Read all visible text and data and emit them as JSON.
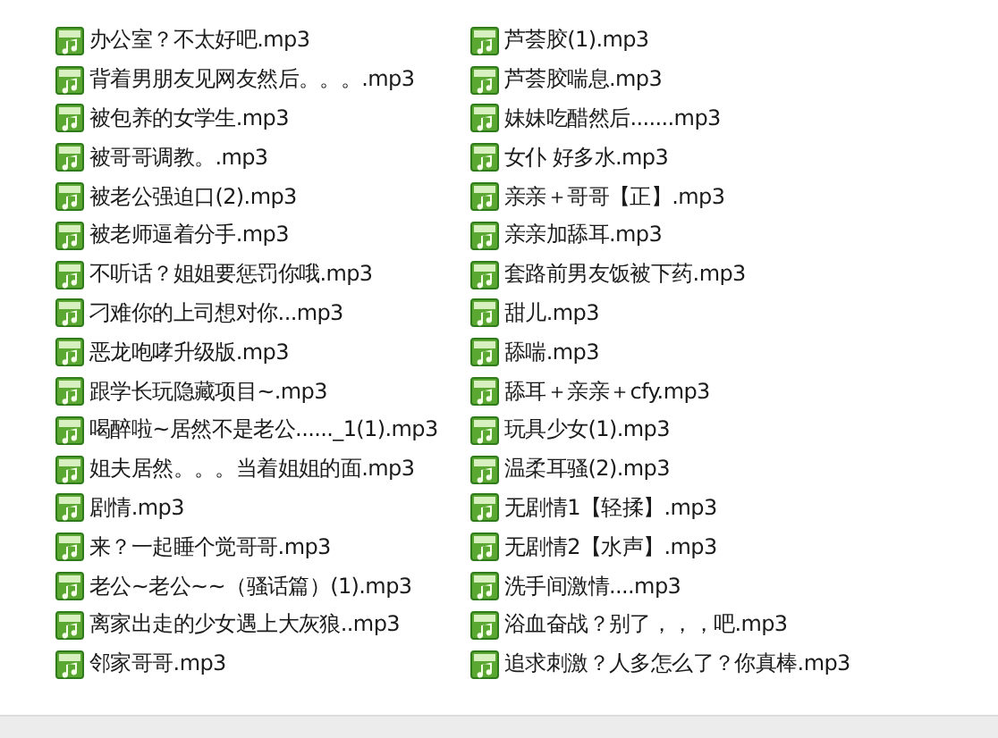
{
  "columns": [
    {
      "files": [
        {
          "name": "办公室？不太好吧.mp3"
        },
        {
          "name": "背着男朋友见网友然后。。。.mp3"
        },
        {
          "name": "被包养的女学生.mp3"
        },
        {
          "name": "被哥哥调教。.mp3"
        },
        {
          "name": "被老公强迫口(2).mp3"
        },
        {
          "name": "被老师逼着分手.mp3"
        },
        {
          "name": "不听话？姐姐要惩罚你哦.mp3"
        },
        {
          "name": "刁难你的上司想对你...mp3"
        },
        {
          "name": "恶龙咆哮升级版.mp3"
        },
        {
          "name": "跟学长玩隐藏项目~.mp3"
        },
        {
          "name": "喝醉啦~居然不是老公......_1(1).mp3"
        },
        {
          "name": "姐夫居然。。。当着姐姐的面.mp3"
        },
        {
          "name": "剧情.mp3"
        },
        {
          "name": "来？一起睡个觉哥哥.mp3"
        },
        {
          "name": "老公~老公~~（骚话篇）(1).mp3"
        },
        {
          "name": "离家出走的少女遇上大灰狼..mp3"
        },
        {
          "name": "邻家哥哥.mp3"
        }
      ]
    },
    {
      "files": [
        {
          "name": "芦荟胶(1).mp3"
        },
        {
          "name": "芦荟胶喘息.mp3"
        },
        {
          "name": "妹妹吃醋然后.......mp3"
        },
        {
          "name": "女仆 好多水.mp3"
        },
        {
          "name": "亲亲＋哥哥【正】.mp3"
        },
        {
          "name": "亲亲加舔耳.mp3"
        },
        {
          "name": "套路前男友饭被下药.mp3"
        },
        {
          "name": "甜儿.mp3"
        },
        {
          "name": "舔喘.mp3"
        },
        {
          "name": "舔耳＋亲亲＋cfy.mp3"
        },
        {
          "name": "玩具少女(1).mp3"
        },
        {
          "name": "温柔耳骚(2).mp3"
        },
        {
          "name": "无剧情1【轻揉】.mp3"
        },
        {
          "name": "无剧情2【水声】.mp3"
        },
        {
          "name": "洗手间激情....mp3"
        },
        {
          "name": "浴血奋战？别了，，，吧.mp3"
        },
        {
          "name": "追求刺激？人多怎么了？你真棒.mp3"
        }
      ]
    }
  ]
}
